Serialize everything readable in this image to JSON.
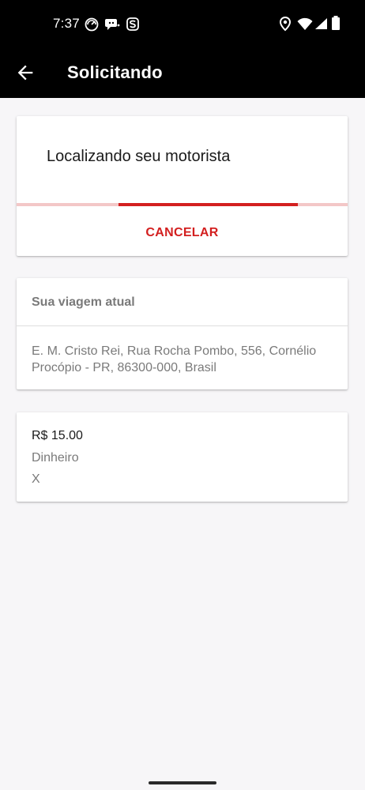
{
  "status_bar": {
    "time": "7:37",
    "icons": [
      "speedometer-icon",
      "chat-icon",
      "s-icon",
      "location-icon",
      "wifi-icon",
      "signal-icon",
      "battery-icon"
    ]
  },
  "app_bar": {
    "title": "Solicitando",
    "back_icon": "arrow-back-icon"
  },
  "request_card": {
    "status_text": "Localizando seu motorista",
    "progress": 0.54,
    "cancel_label": "CANCELAR"
  },
  "trip_card": {
    "header": "Sua viagem atual",
    "address": "E. M. Cristo Rei, Rua Rocha Pombo, 556, Cornélio Procópio - PR, 86300-000, Brasil"
  },
  "payment_card": {
    "price": "R$ 15.00",
    "method": "Dinheiro",
    "extra": "X"
  },
  "colors": {
    "accent": "#d31f1f",
    "appbar_bg": "#000000",
    "page_bg": "#f7f6f8",
    "progress_track": "#f3c7c7"
  }
}
